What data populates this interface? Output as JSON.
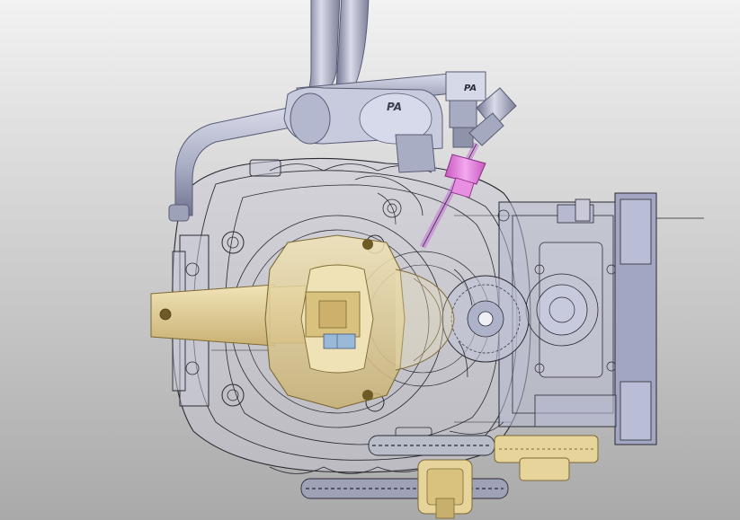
{
  "viewport": {
    "background_top": "#f2f2f2",
    "background_bottom": "#a9a9a9"
  },
  "model": {
    "colors": {
      "steel": "#b6b9cf",
      "steel_dark": "#7b7f98",
      "steel_light": "#e3e5f0",
      "wire": "#2a2a33",
      "ghost_fill": "#c9c9d8",
      "gold": "#e7d49b",
      "gold_dark": "#a88f4c",
      "pink": "#e07ad8",
      "blue_glass": "#9ab8d8"
    },
    "arm_lettering": "PA",
    "fitting_lettering": "PA"
  }
}
